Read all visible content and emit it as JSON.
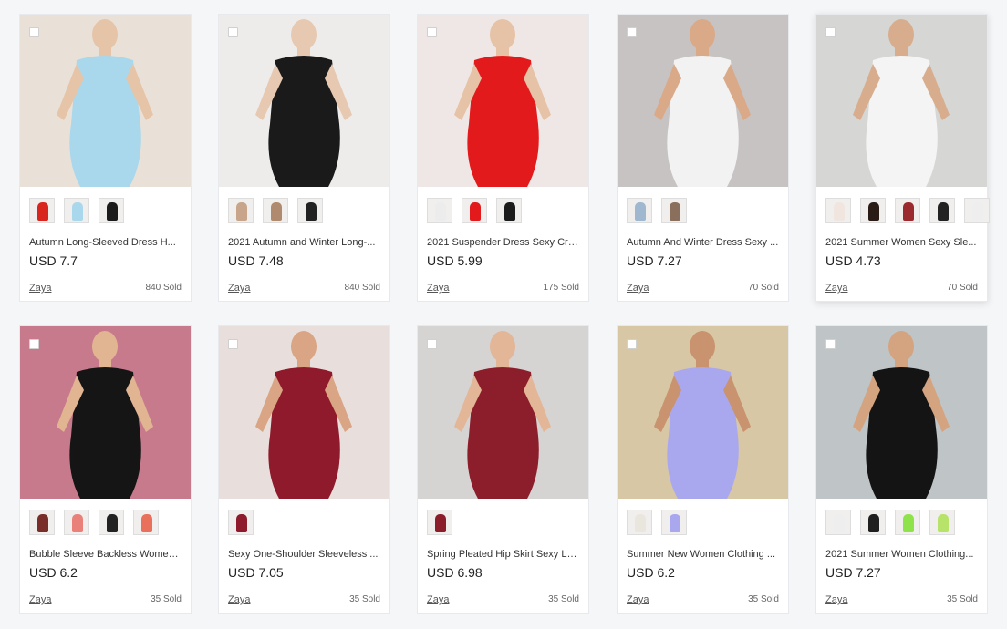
{
  "products": [
    {
      "title": "Autumn Long-Sleeved Dress H...",
      "price": "USD 7.7",
      "seller": "Zaya",
      "sold": "840 Sold",
      "image_desc": "light-blue-dress",
      "bg": "#e9e1d8",
      "dress": "#a9d8ec",
      "skin": "#e6c4a8",
      "swatch_colors": [
        "#d8251e",
        "#a9d8ec",
        "#1b1b1b"
      ],
      "hover": false
    },
    {
      "title": "2021 Autumn and Winter Long-...",
      "price": "USD 7.48",
      "seller": "Zaya",
      "sold": "840 Sold",
      "image_desc": "black-dress",
      "bg": "#eeeceb",
      "dress": "#1a1a1a",
      "skin": "#e7c9b1",
      "swatch_colors": [
        "#c8a58a",
        "#b08a6e",
        "#222222"
      ],
      "hover": false
    },
    {
      "title": "2021 Suspender Dress Sexy Cro...",
      "price": "USD 5.99",
      "seller": "Zaya",
      "sold": "175 Sold",
      "image_desc": "red-dress",
      "bg": "#efe7e5",
      "dress": "#e31a1c",
      "skin": "#e6c2a6",
      "swatch_colors": [
        "#ececec",
        "#e31a1c",
        "#1b1b1b"
      ],
      "hover": false
    },
    {
      "title": "Autumn And Winter Dress Sexy ...",
      "price": "USD 7.27",
      "seller": "Zaya",
      "sold": "70 Sold",
      "image_desc": "white-dress",
      "bg": "#c7c3c2",
      "dress": "#f2f2f2",
      "skin": "#d9a988",
      "swatch_colors": [
        "#9fb7cf",
        "#8b6f5d"
      ],
      "hover": false
    },
    {
      "title": "2021 Summer Women Sexy Sle...",
      "price": "USD 4.73",
      "seller": "Zaya",
      "sold": "70 Sold",
      "image_desc": "white-bodycon-street",
      "bg": "#d6d6d4",
      "dress": "#f4f4f4",
      "skin": "#d8ad8d",
      "swatch_colors": [
        "#f0e6df",
        "#2b1b15",
        "#9b2a2f",
        "#222222",
        "#eeeeee"
      ],
      "hover": true
    },
    {
      "title": "Bubble Sleeve Backless Women ...",
      "price": "USD 6.2",
      "seller": "Zaya",
      "sold": "35 Sold",
      "image_desc": "black-puff-sleeve",
      "bg": "#c77a8c",
      "dress": "#151515",
      "skin": "#e1b592",
      "swatch_colors": [
        "#7a2e2a",
        "#e9817a",
        "#222222",
        "#e9705a"
      ],
      "hover": false
    },
    {
      "title": "Sexy One-Shoulder Sleeveless ...",
      "price": "USD 7.05",
      "seller": "Zaya",
      "sold": "35 Sold",
      "image_desc": "burgundy-satin",
      "bg": "#e8dfdc",
      "dress": "#8e1a2b",
      "skin": "#d9a584",
      "swatch_colors": [
        "#8e1a2b"
      ],
      "hover": false
    },
    {
      "title": "Spring Pleated Hip Skirt Sexy Lo...",
      "price": "USD 6.98",
      "seller": "Zaya",
      "sold": "35 Sold",
      "image_desc": "burgundy-long-sleeve",
      "bg": "#d6d3d3",
      "dress": "#8c1e2c",
      "skin": "#e2b696",
      "swatch_colors": [
        "#8c1e2c"
      ],
      "hover": false
    },
    {
      "title": "Summer New Women Clothing ...",
      "price": "USD 6.2",
      "seller": "Zaya",
      "sold": "35 Sold",
      "image_desc": "lavender-dress",
      "bg": "#d8c7a4",
      "dress": "#a9a8ee",
      "skin": "#c8936e",
      "swatch_colors": [
        "#e9e6de",
        "#a9a8ee"
      ],
      "hover": false
    },
    {
      "title": "2021 Summer Women Clothing...",
      "price": "USD 7.27",
      "seller": "Zaya",
      "sold": "35 Sold",
      "image_desc": "black-strapless-midi",
      "bg": "#bfc4c7",
      "dress": "#141414",
      "skin": "#d4a481",
      "swatch_colors": [
        "#eeeeee",
        "#1f1f1f",
        "#8ee34a",
        "#b7e36a"
      ],
      "hover": false
    }
  ]
}
